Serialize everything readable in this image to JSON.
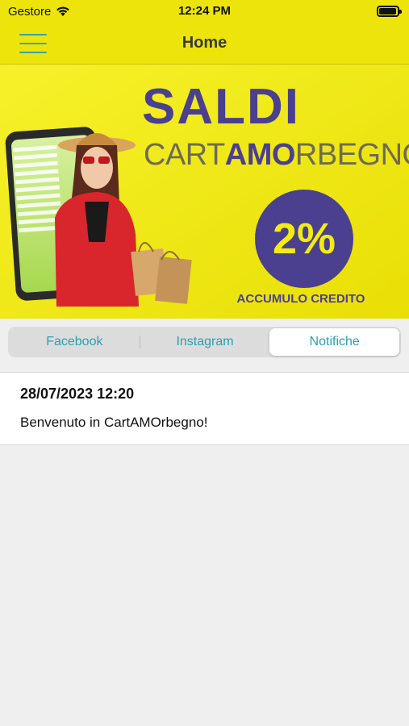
{
  "status_bar": {
    "carrier": "Gestore",
    "time": "12:24 PM",
    "battery_level": 0.95
  },
  "nav": {
    "title": "Home",
    "menu_icon": "hamburger-menu-icon"
  },
  "banner": {
    "headline": "SALDI",
    "brand_part1": "CART",
    "brand_part2": "AMO",
    "brand_part3": "RBEGNO",
    "badge_value": "2%",
    "caption": "ACCUMULO CREDITO"
  },
  "tabs": [
    {
      "label": "Facebook",
      "active": false
    },
    {
      "label": "Instagram",
      "active": false
    },
    {
      "label": "Notifiche",
      "active": true
    }
  ],
  "notifications": [
    {
      "date": "28/07/2023 12:20",
      "message": "Benvenuto in CartAMOrbegno!"
    }
  ],
  "colors": {
    "bar_yellow": "#ede40b",
    "accent_teal": "#2a9fb0",
    "banner_purple": "#4b3f8f"
  }
}
